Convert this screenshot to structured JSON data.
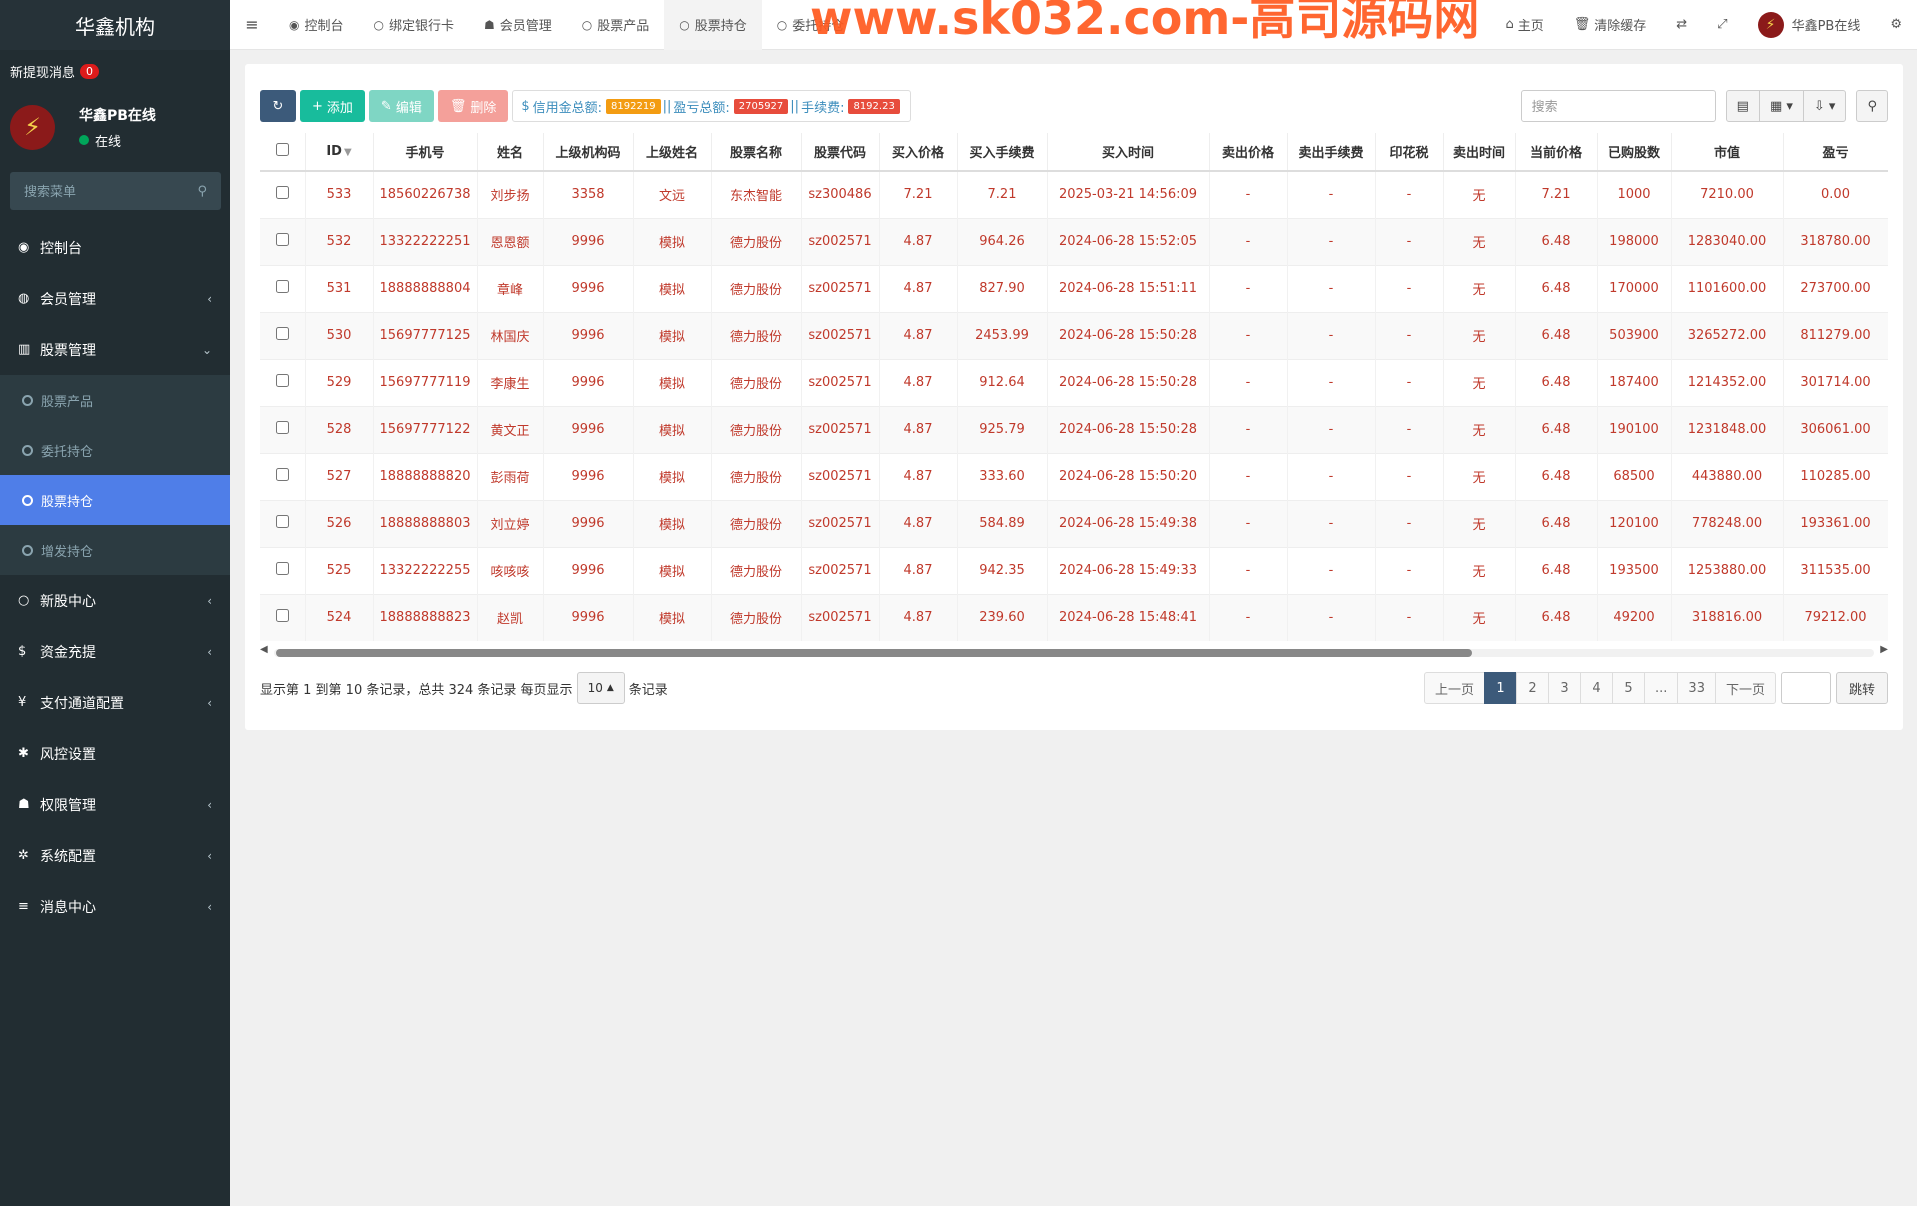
{
  "app": {
    "title": "华鑫机构"
  },
  "sidebar": {
    "new_msg_label": "新提现消息",
    "new_msg_count": "0",
    "user_name": "华鑫PB在线",
    "user_status": "在线",
    "search_placeholder": "搜索菜单",
    "items": [
      {
        "label": "控制台",
        "icon": "dashboard-icon"
      },
      {
        "label": "会员管理",
        "icon": "user-circle-icon"
      },
      {
        "label": "股票管理",
        "icon": "bank-icon"
      },
      {
        "label": "新股中心",
        "icon": "circle-icon"
      },
      {
        "label": "资金充提",
        "icon": "dollar-icon"
      },
      {
        "label": "支付通道配置",
        "icon": "yen-icon"
      },
      {
        "label": "风控设置",
        "icon": "gear-icon"
      },
      {
        "label": "权限管理",
        "icon": "users-icon"
      },
      {
        "label": "系统配置",
        "icon": "cog-icon"
      },
      {
        "label": "消息中心",
        "icon": "list-icon"
      }
    ],
    "sub_items": [
      {
        "label": "股票产品"
      },
      {
        "label": "委托持仓"
      },
      {
        "label": "股票持仓"
      },
      {
        "label": "增发持仓"
      }
    ]
  },
  "topbar": {
    "tabs": [
      "控制台",
      "绑定银行卡",
      "会员管理",
      "股票产品",
      "股票持仓",
      "委托持仓"
    ],
    "home": "主页",
    "clear_cache": "清除缓存",
    "user": "华鑫PB在线",
    "watermark": "www.sk032.com-高司源码网"
  },
  "toolbar": {
    "add": "添加",
    "edit": "编辑",
    "delete": "删除",
    "credit_label": "信用金总额:",
    "credit_value": "8192219",
    "pnl_label": "盈亏总额:",
    "pnl_value": "2705927",
    "fee_label": "手续费:",
    "fee_value": "8192.23",
    "search_placeholder": "搜索",
    "colors": {
      "credit": "#f39c12",
      "pnl": "#e74c3c",
      "fee": "#e74c3c"
    }
  },
  "table": {
    "headers": [
      "ID",
      "手机号",
      "姓名",
      "上级机构码",
      "上级姓名",
      "股票名称",
      "股票代码",
      "买入价格",
      "买入手续费",
      "买入时间",
      "卖出价格",
      "卖出手续费",
      "印花税",
      "卖出时间",
      "当前价格",
      "已购股数",
      "市值",
      "盈亏"
    ],
    "rows": [
      [
        "533",
        "18560226738",
        "刘步扬",
        "3358",
        "文远",
        "东杰智能",
        "sz300486",
        "7.21",
        "7.21",
        "2025-03-21 14:56:09",
        "-",
        "-",
        "-",
        "无",
        "7.21",
        "1000",
        "7210.00",
        "0.00"
      ],
      [
        "532",
        "13322222251",
        "恩恩额",
        "9996",
        "模拟",
        "德力股份",
        "sz002571",
        "4.87",
        "964.26",
        "2024-06-28 15:52:05",
        "-",
        "-",
        "-",
        "无",
        "6.48",
        "198000",
        "1283040.00",
        "318780.00"
      ],
      [
        "531",
        "18888888804",
        "章峰",
        "9996",
        "模拟",
        "德力股份",
        "sz002571",
        "4.87",
        "827.90",
        "2024-06-28 15:51:11",
        "-",
        "-",
        "-",
        "无",
        "6.48",
        "170000",
        "1101600.00",
        "273700.00"
      ],
      [
        "530",
        "15697777125",
        "林国庆",
        "9996",
        "模拟",
        "德力股份",
        "sz002571",
        "4.87",
        "2453.99",
        "2024-06-28 15:50:28",
        "-",
        "-",
        "-",
        "无",
        "6.48",
        "503900",
        "3265272.00",
        "811279.00"
      ],
      [
        "529",
        "15697777119",
        "李康生",
        "9996",
        "模拟",
        "德力股份",
        "sz002571",
        "4.87",
        "912.64",
        "2024-06-28 15:50:28",
        "-",
        "-",
        "-",
        "无",
        "6.48",
        "187400",
        "1214352.00",
        "301714.00"
      ],
      [
        "528",
        "15697777122",
        "黄文正",
        "9996",
        "模拟",
        "德力股份",
        "sz002571",
        "4.87",
        "925.79",
        "2024-06-28 15:50:28",
        "-",
        "-",
        "-",
        "无",
        "6.48",
        "190100",
        "1231848.00",
        "306061.00"
      ],
      [
        "527",
        "18888888820",
        "彭雨荷",
        "9996",
        "模拟",
        "德力股份",
        "sz002571",
        "4.87",
        "333.60",
        "2024-06-28 15:50:20",
        "-",
        "-",
        "-",
        "无",
        "6.48",
        "68500",
        "443880.00",
        "110285.00"
      ],
      [
        "526",
        "18888888803",
        "刘立婷",
        "9996",
        "模拟",
        "德力股份",
        "sz002571",
        "4.87",
        "584.89",
        "2024-06-28 15:49:38",
        "-",
        "-",
        "-",
        "无",
        "6.48",
        "120100",
        "778248.00",
        "193361.00"
      ],
      [
        "525",
        "13322222255",
        "咳咳咳",
        "9996",
        "模拟",
        "德力股份",
        "sz002571",
        "4.87",
        "942.35",
        "2024-06-28 15:49:33",
        "-",
        "-",
        "-",
        "无",
        "6.48",
        "193500",
        "1253880.00",
        "311535.00"
      ],
      [
        "524",
        "18888888823",
        "赵凯",
        "9996",
        "模拟",
        "德力股份",
        "sz002571",
        "4.87",
        "239.60",
        "2024-06-28 15:48:41",
        "-",
        "-",
        "-",
        "无",
        "6.48",
        "49200",
        "318816.00",
        "79212.00"
      ]
    ]
  },
  "footer": {
    "info_prefix": "显示第 1 到第 10 条记录，总共 324 条记录 每页显示",
    "page_size": "10",
    "info_suffix": "条记录",
    "prev": "上一页",
    "next": "下一页",
    "pages": [
      "1",
      "2",
      "3",
      "4",
      "5",
      "...",
      "33"
    ],
    "jump": "跳转"
  }
}
